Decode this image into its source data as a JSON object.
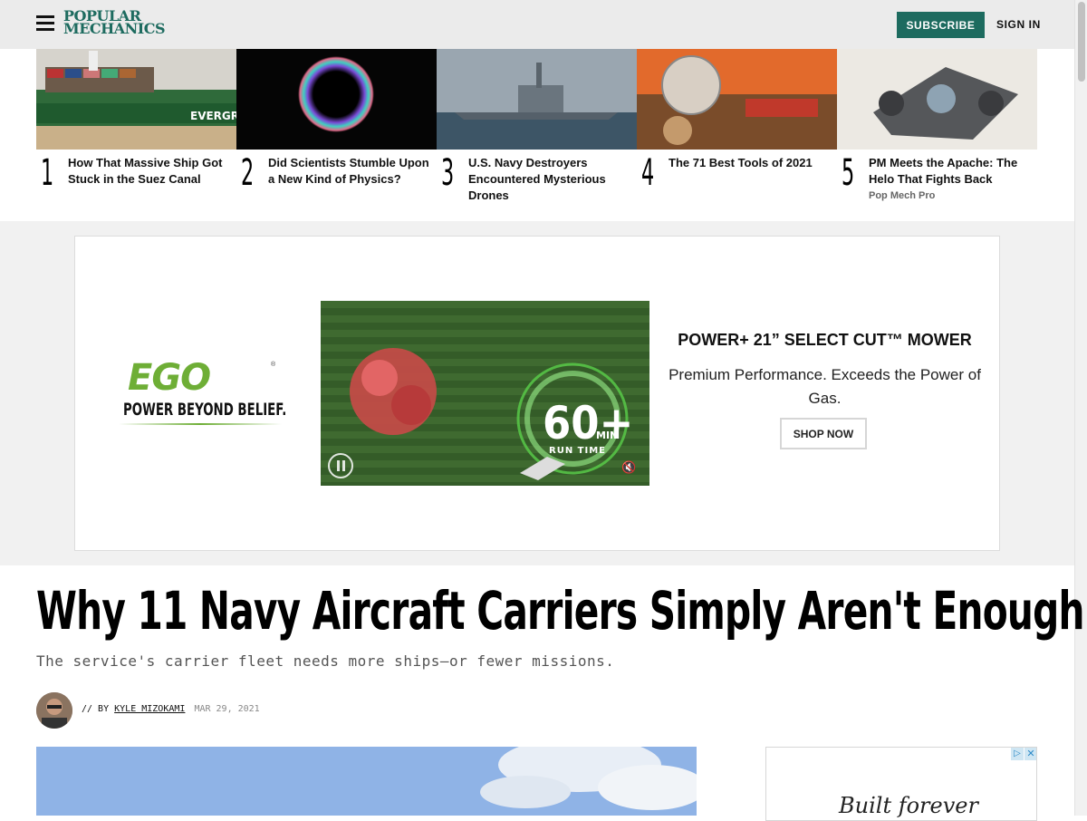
{
  "header": {
    "logo_line1": "POPULAR",
    "logo_line2": "MECHANICS",
    "subscribe_label": "SUBSCRIBE",
    "signin_label": "SIGN IN"
  },
  "trending": [
    {
      "rank": "1",
      "title": "How That Massive Ship Got Stuck in the Suez Canal",
      "tag": ""
    },
    {
      "rank": "2",
      "title": "Did Scientists Stumble Upon a New Kind of Physics?",
      "tag": ""
    },
    {
      "rank": "3",
      "title": "U.S. Navy Destroyers Encountered Mysterious Drones",
      "tag": ""
    },
    {
      "rank": "4",
      "title": "The 71 Best Tools of 2021",
      "tag": ""
    },
    {
      "rank": "5",
      "title": "PM Meets the Apache: The Helo That Fights Back",
      "tag": "Pop Mech Pro"
    }
  ],
  "ad": {
    "brand": "EGO",
    "brand_tagline": "POWER BEYOND BELIEF.",
    "video_runtime_value": "60+",
    "video_runtime_unit": "MIN",
    "video_runtime_label": "RUN TIME",
    "headline": "POWER+ 21” SELECT CUT™ MOWER",
    "description": "Premium Performance. Exceeds the Power of Gas.",
    "cta_label": "SHOP NOW",
    "ship_name": "EVERGREEN"
  },
  "article": {
    "title": "Why 11 Navy Aircraft Carriers Simply Aren't Enough",
    "dek": "The service's carrier fleet needs more ships—or fewer missions.",
    "byline_prefix": "// BY",
    "author": "KYLE MIZOKAMI",
    "date": "MAR 29, 2021"
  },
  "side_ad": {
    "script_text": "Built forever"
  },
  "colors": {
    "brand_green": "#1d6b5f",
    "ego_green": "#6eae36",
    "header_bg": "#ebebeb",
    "ad_band_bg": "#f1f1f1"
  }
}
